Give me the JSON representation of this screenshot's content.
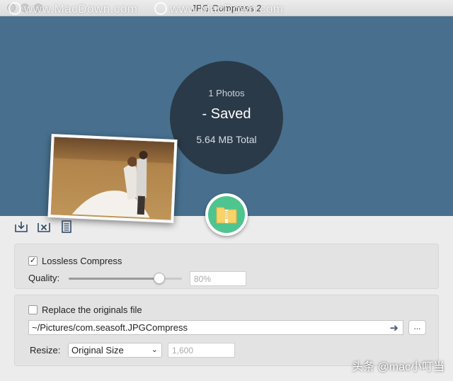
{
  "window": {
    "title": "JPG Compress 2"
  },
  "watermark": {
    "text_1": "www.MacDown.com",
    "text_2": "www.MacDown.com",
    "corner": "头条 @mac小叮当"
  },
  "summary": {
    "photos": "1 Photos",
    "saved": "- Saved",
    "total": "5.64 MB Total"
  },
  "toolbar": {
    "items": [
      "import-icon",
      "clear-icon",
      "list-icon"
    ]
  },
  "compress": {
    "lossless_label": "Lossless Compress",
    "lossless_checked": true,
    "quality_label": "Quality:",
    "quality_value": 0.8,
    "quality_placeholder": "80%"
  },
  "output": {
    "replace_label": "Replace the originals file",
    "replace_checked": false,
    "path": "~/Pictures/com.seasoft.JPGCompress",
    "more_label": "...",
    "resize_label": "Resize:",
    "resize_option": "Original Size",
    "size_placeholder": "1,600"
  },
  "colors": {
    "hero_bg": "#48708e",
    "circle_bg": "#2b3a48",
    "action_green": "#4ec48f"
  }
}
